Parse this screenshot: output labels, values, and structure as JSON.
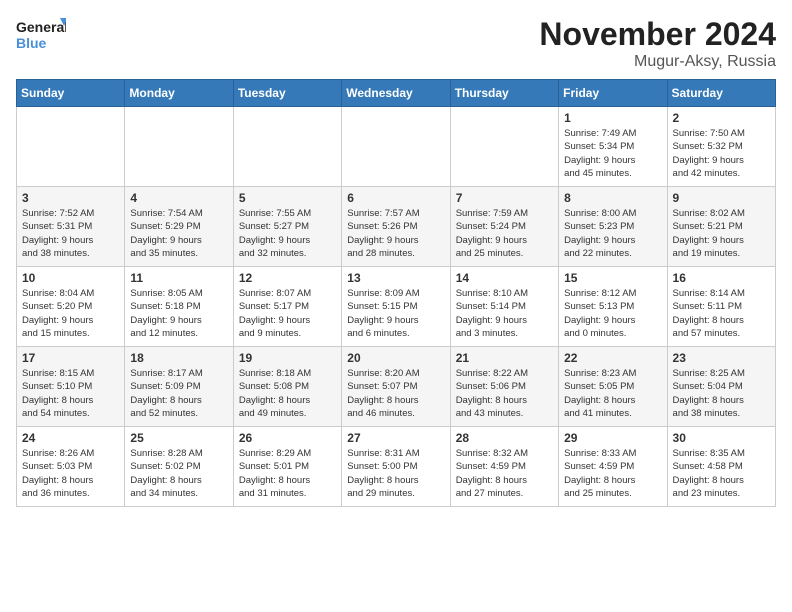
{
  "logo": {
    "line1": "General",
    "line2": "Blue"
  },
  "title": "November 2024",
  "location": "Mugur-Aksy, Russia",
  "weekdays": [
    "Sunday",
    "Monday",
    "Tuesday",
    "Wednesday",
    "Thursday",
    "Friday",
    "Saturday"
  ],
  "weeks": [
    [
      {
        "day": "",
        "info": ""
      },
      {
        "day": "",
        "info": ""
      },
      {
        "day": "",
        "info": ""
      },
      {
        "day": "",
        "info": ""
      },
      {
        "day": "",
        "info": ""
      },
      {
        "day": "1",
        "info": "Sunrise: 7:49 AM\nSunset: 5:34 PM\nDaylight: 9 hours\nand 45 minutes."
      },
      {
        "day": "2",
        "info": "Sunrise: 7:50 AM\nSunset: 5:32 PM\nDaylight: 9 hours\nand 42 minutes."
      }
    ],
    [
      {
        "day": "3",
        "info": "Sunrise: 7:52 AM\nSunset: 5:31 PM\nDaylight: 9 hours\nand 38 minutes."
      },
      {
        "day": "4",
        "info": "Sunrise: 7:54 AM\nSunset: 5:29 PM\nDaylight: 9 hours\nand 35 minutes."
      },
      {
        "day": "5",
        "info": "Sunrise: 7:55 AM\nSunset: 5:27 PM\nDaylight: 9 hours\nand 32 minutes."
      },
      {
        "day": "6",
        "info": "Sunrise: 7:57 AM\nSunset: 5:26 PM\nDaylight: 9 hours\nand 28 minutes."
      },
      {
        "day": "7",
        "info": "Sunrise: 7:59 AM\nSunset: 5:24 PM\nDaylight: 9 hours\nand 25 minutes."
      },
      {
        "day": "8",
        "info": "Sunrise: 8:00 AM\nSunset: 5:23 PM\nDaylight: 9 hours\nand 22 minutes."
      },
      {
        "day": "9",
        "info": "Sunrise: 8:02 AM\nSunset: 5:21 PM\nDaylight: 9 hours\nand 19 minutes."
      }
    ],
    [
      {
        "day": "10",
        "info": "Sunrise: 8:04 AM\nSunset: 5:20 PM\nDaylight: 9 hours\nand 15 minutes."
      },
      {
        "day": "11",
        "info": "Sunrise: 8:05 AM\nSunset: 5:18 PM\nDaylight: 9 hours\nand 12 minutes."
      },
      {
        "day": "12",
        "info": "Sunrise: 8:07 AM\nSunset: 5:17 PM\nDaylight: 9 hours\nand 9 minutes."
      },
      {
        "day": "13",
        "info": "Sunrise: 8:09 AM\nSunset: 5:15 PM\nDaylight: 9 hours\nand 6 minutes."
      },
      {
        "day": "14",
        "info": "Sunrise: 8:10 AM\nSunset: 5:14 PM\nDaylight: 9 hours\nand 3 minutes."
      },
      {
        "day": "15",
        "info": "Sunrise: 8:12 AM\nSunset: 5:13 PM\nDaylight: 9 hours\nand 0 minutes."
      },
      {
        "day": "16",
        "info": "Sunrise: 8:14 AM\nSunset: 5:11 PM\nDaylight: 8 hours\nand 57 minutes."
      }
    ],
    [
      {
        "day": "17",
        "info": "Sunrise: 8:15 AM\nSunset: 5:10 PM\nDaylight: 8 hours\nand 54 minutes."
      },
      {
        "day": "18",
        "info": "Sunrise: 8:17 AM\nSunset: 5:09 PM\nDaylight: 8 hours\nand 52 minutes."
      },
      {
        "day": "19",
        "info": "Sunrise: 8:18 AM\nSunset: 5:08 PM\nDaylight: 8 hours\nand 49 minutes."
      },
      {
        "day": "20",
        "info": "Sunrise: 8:20 AM\nSunset: 5:07 PM\nDaylight: 8 hours\nand 46 minutes."
      },
      {
        "day": "21",
        "info": "Sunrise: 8:22 AM\nSunset: 5:06 PM\nDaylight: 8 hours\nand 43 minutes."
      },
      {
        "day": "22",
        "info": "Sunrise: 8:23 AM\nSunset: 5:05 PM\nDaylight: 8 hours\nand 41 minutes."
      },
      {
        "day": "23",
        "info": "Sunrise: 8:25 AM\nSunset: 5:04 PM\nDaylight: 8 hours\nand 38 minutes."
      }
    ],
    [
      {
        "day": "24",
        "info": "Sunrise: 8:26 AM\nSunset: 5:03 PM\nDaylight: 8 hours\nand 36 minutes."
      },
      {
        "day": "25",
        "info": "Sunrise: 8:28 AM\nSunset: 5:02 PM\nDaylight: 8 hours\nand 34 minutes."
      },
      {
        "day": "26",
        "info": "Sunrise: 8:29 AM\nSunset: 5:01 PM\nDaylight: 8 hours\nand 31 minutes."
      },
      {
        "day": "27",
        "info": "Sunrise: 8:31 AM\nSunset: 5:00 PM\nDaylight: 8 hours\nand 29 minutes."
      },
      {
        "day": "28",
        "info": "Sunrise: 8:32 AM\nSunset: 4:59 PM\nDaylight: 8 hours\nand 27 minutes."
      },
      {
        "day": "29",
        "info": "Sunrise: 8:33 AM\nSunset: 4:59 PM\nDaylight: 8 hours\nand 25 minutes."
      },
      {
        "day": "30",
        "info": "Sunrise: 8:35 AM\nSunset: 4:58 PM\nDaylight: 8 hours\nand 23 minutes."
      }
    ]
  ]
}
